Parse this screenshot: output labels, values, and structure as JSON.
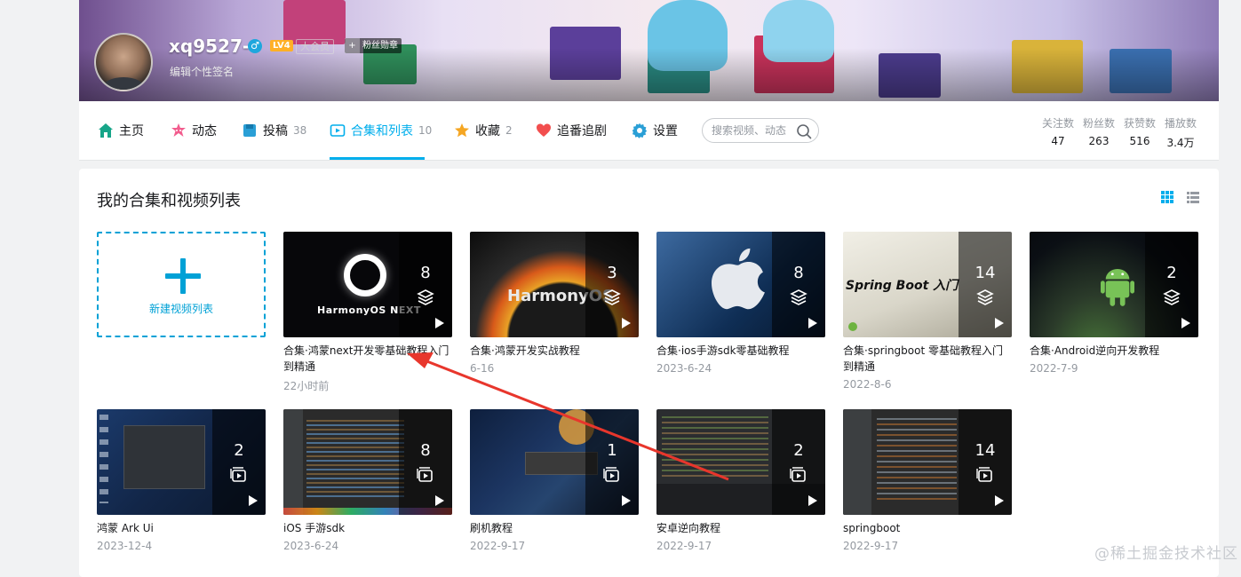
{
  "header": {
    "username": "xq9527--",
    "gender_symbol": "♂",
    "level": "LV4",
    "vip_label": "大会员",
    "fan_badge": "粉丝勋章",
    "fan_badge_plus": "+",
    "signature": "编辑个性签名"
  },
  "nav": {
    "items": [
      {
        "label": "主页",
        "count": ""
      },
      {
        "label": "动态",
        "count": ""
      },
      {
        "label": "投稿",
        "count": "38"
      },
      {
        "label": "合集和列表",
        "count": "10"
      },
      {
        "label": "收藏",
        "count": "2"
      },
      {
        "label": "追番追剧",
        "count": ""
      },
      {
        "label": "设置",
        "count": ""
      }
    ],
    "active_index": 3,
    "search_placeholder": "搜索视频、动态",
    "stats": [
      {
        "label": "关注数",
        "value": "47"
      },
      {
        "label": "粉丝数",
        "value": "263"
      },
      {
        "label": "获赞数",
        "value": "516"
      },
      {
        "label": "播放数",
        "value": "3.4万"
      }
    ]
  },
  "main": {
    "section_title": "我的合集和视频列表",
    "new_list_label": "新建视频列表",
    "cards": [
      {
        "title": "合集·鸿蒙next开发零基础教程入门到精通",
        "date": "22小时前",
        "count": "8",
        "kind": "collection",
        "thumb_text": "HarmonyOS NEXT"
      },
      {
        "title": "合集·鸿蒙开发实战教程",
        "date": "6-16",
        "count": "3",
        "kind": "collection",
        "thumb_text": "HarmonyOS"
      },
      {
        "title": "合集·ios手游sdk零基础教程",
        "date": "2023-6-24",
        "count": "8",
        "kind": "collection",
        "thumb_text": ""
      },
      {
        "title": "合集·springboot 零基础教程入门到精通",
        "date": "2022-8-6",
        "count": "14",
        "kind": "collection",
        "thumb_text": "Spring Boot 入门"
      },
      {
        "title": "合集·Android逆向开发教程",
        "date": "2022-7-9",
        "count": "2",
        "kind": "collection",
        "thumb_text": ""
      },
      {
        "title": "鸿蒙 Ark Ui",
        "date": "2023-12-4",
        "count": "2",
        "kind": "list",
        "thumb_text": ""
      },
      {
        "title": "iOS 手游sdk",
        "date": "2023-6-24",
        "count": "8",
        "kind": "list",
        "thumb_text": ""
      },
      {
        "title": "刷机教程",
        "date": "2022-9-17",
        "count": "1",
        "kind": "list",
        "thumb_text": ""
      },
      {
        "title": "安卓逆向教程",
        "date": "2022-9-17",
        "count": "2",
        "kind": "list",
        "thumb_text": ""
      },
      {
        "title": "springboot",
        "date": "2022-9-17",
        "count": "14",
        "kind": "list",
        "thumb_text": ""
      }
    ]
  },
  "watermark": "@稀土掘金技术社区",
  "colors": {
    "accent": "#00aeec",
    "new_list_border": "#00a1d6",
    "annotation_arrow": "#e8362c",
    "level_badge": "#ffb027"
  }
}
